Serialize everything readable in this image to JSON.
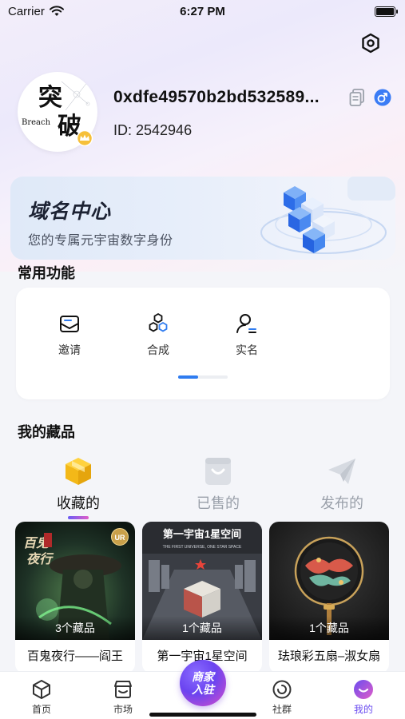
{
  "status_bar": {
    "carrier": "Carrier",
    "time": "6:27 PM"
  },
  "profile": {
    "avatar_text_main": "突破",
    "avatar_text_sub": "Breach",
    "address": "0xdfe49570b2bd532589...",
    "id_text": "ID: 2542946"
  },
  "domain_banner": {
    "title": "域名中心",
    "subtitle": "您的专属元宇宙数字身份"
  },
  "common_functions": {
    "title": "常用功能",
    "items": [
      {
        "label": "邀请",
        "icon": "invite-mail-icon"
      },
      {
        "label": "合成",
        "icon": "compose-hexagons-icon"
      },
      {
        "label": "实名",
        "icon": "real-name-user-icon"
      }
    ],
    "page_progress": 0.4
  },
  "collection": {
    "title": "我的藏品",
    "tabs": [
      {
        "label": "收藏的",
        "icon": "box-icon",
        "active": true
      },
      {
        "label": "已售的",
        "icon": "bag-icon",
        "active": false
      },
      {
        "label": "发布的",
        "icon": "paper-plane-icon",
        "active": false
      }
    ],
    "cards": [
      {
        "count": "3个藏品",
        "name": "百鬼夜行——阎王",
        "badge": "UR",
        "art_text": "百鬼夜行"
      },
      {
        "count": "1个藏品",
        "name": "第一宇宙1星空间",
        "art_text": "第一宇宙1星空间",
        "art_sub": "THE FIRST UNIVERSE, ONE STAR SPACE"
      },
      {
        "count": "1个藏品",
        "name": "珐琅彩五扇–淑女扇"
      }
    ]
  },
  "tabbar": {
    "items": [
      {
        "label": "首页",
        "icon": "home-cube-icon"
      },
      {
        "label": "市场",
        "icon": "market-store-icon"
      },
      {
        "label": "社群",
        "icon": "community-icon"
      },
      {
        "label": "我的",
        "icon": "profile-face-icon",
        "active": true
      }
    ],
    "center_line1": "商家",
    "center_line2": "入驻"
  },
  "colors": {
    "accent": "#6a4cf0",
    "pager": "#2f7cf0",
    "gradient_pink": "#e05dc8"
  }
}
